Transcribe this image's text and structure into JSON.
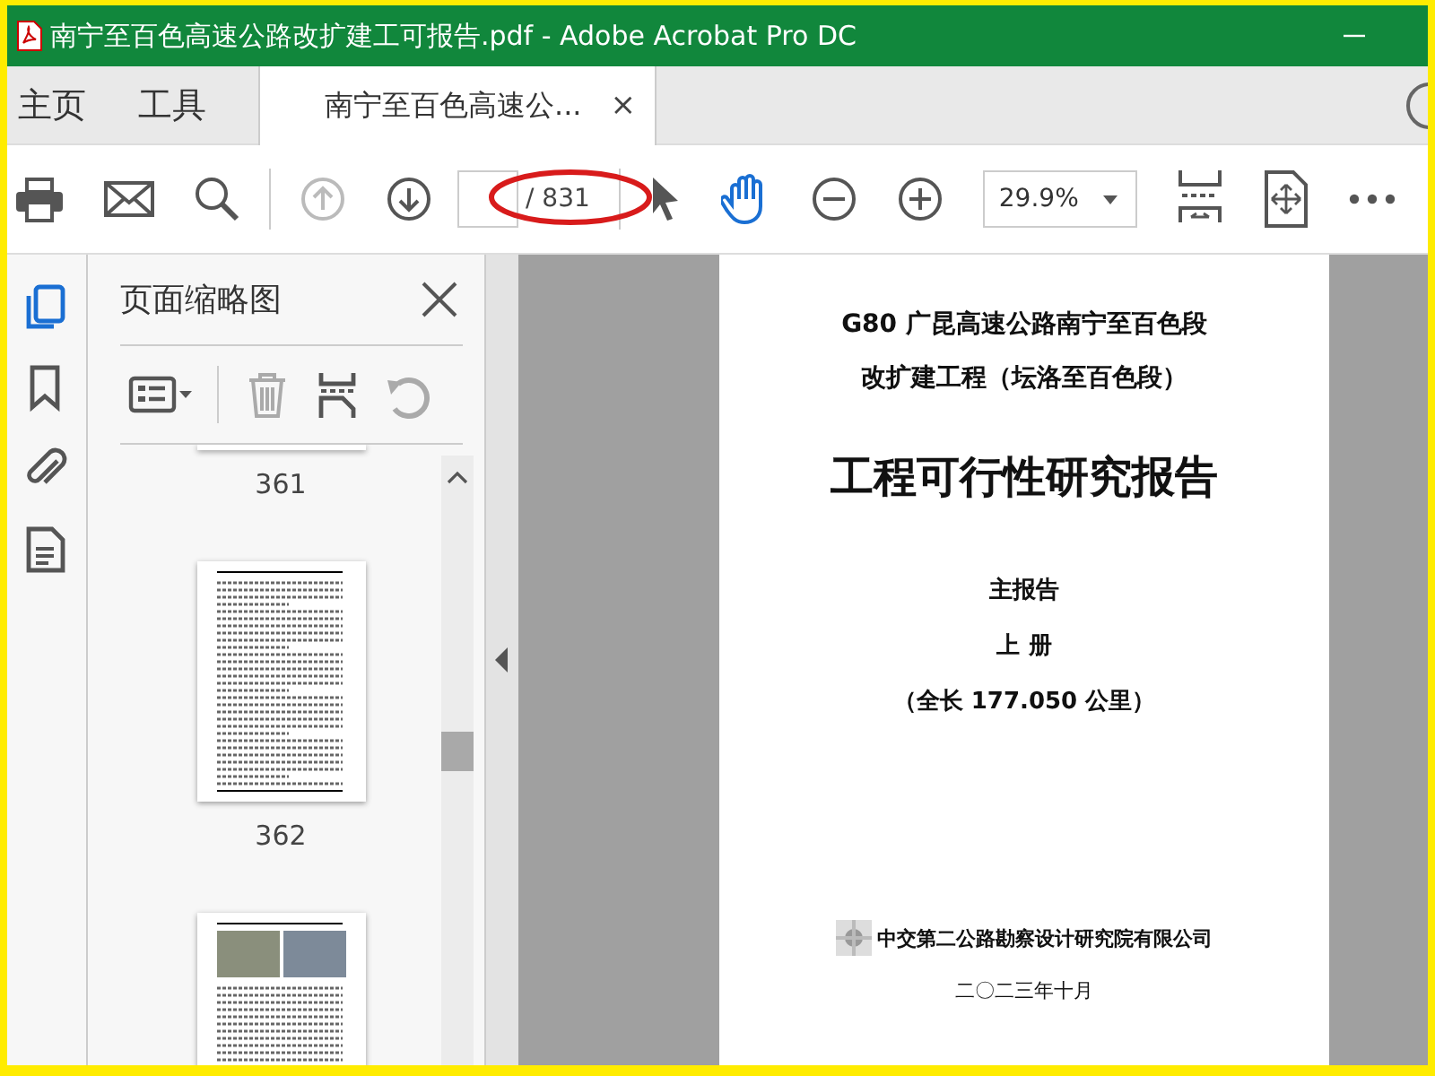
{
  "window": {
    "title": "南宁至百色高速公路改扩建工可报告.pdf - Adobe Acrobat Pro DC"
  },
  "tabs": [
    {
      "label": "主页",
      "selected": false
    },
    {
      "label": "工具",
      "selected": false
    },
    {
      "label": "南宁至百色高速公...",
      "selected": true,
      "close": "×"
    }
  ],
  "toolbar": {
    "page_count": "/ 831",
    "zoom": "29.9%"
  },
  "left_rail": [
    {
      "kind": "pages",
      "selected": true
    },
    {
      "kind": "bookmark",
      "selected": false
    },
    {
      "kind": "attachment",
      "selected": false
    },
    {
      "kind": "document",
      "selected": false
    }
  ],
  "panel": {
    "title": "页面缩略图",
    "tools": [
      {
        "kind": "options",
        "disabled": false
      },
      {
        "kind": "delete",
        "disabled": true
      },
      {
        "kind": "extract",
        "disabled": false
      },
      {
        "kind": "rotate",
        "disabled": true
      }
    ],
    "thumbnails": [
      {
        "kind": "cut",
        "label": "361"
      },
      {
        "kind": "text",
        "label": "362"
      },
      {
        "kind": "photos"
      }
    ]
  },
  "document": {
    "lines": [
      {
        "kind": "subtitle",
        "text": "G80 广昆高速公路南宁至百色段"
      },
      {
        "kind": "subtitle",
        "text": "改扩建工程（坛洛至百色段）"
      },
      {
        "kind": "title",
        "text": "工程可行性研究报告"
      },
      {
        "kind": "label",
        "text": "主报告"
      },
      {
        "kind": "label",
        "text": "上  册"
      },
      {
        "kind": "label",
        "text": "（全长 177.050 公里）"
      },
      {
        "kind": "org",
        "text": "中交第二公路勘察设计研究院有限公司"
      },
      {
        "kind": "date",
        "text": "二〇二三年十月"
      }
    ]
  }
}
